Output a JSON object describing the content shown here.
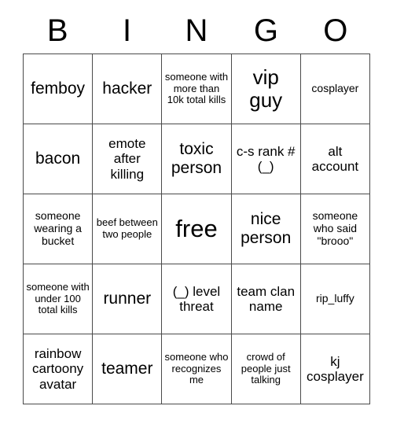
{
  "card": {
    "header_letters": [
      "B",
      "I",
      "N",
      "G",
      "O"
    ],
    "rows": [
      [
        {
          "text": "femboy",
          "size": "fs-md"
        },
        {
          "text": "hacker",
          "size": "fs-md"
        },
        {
          "text": "someone with more than 10k total kills",
          "size": "fs-xxs"
        },
        {
          "text": "vip guy",
          "size": "fs-lg"
        },
        {
          "text": "cosplayer",
          "size": "fs-xs"
        }
      ],
      [
        {
          "text": "bacon",
          "size": "fs-md"
        },
        {
          "text": "emote after killing",
          "size": "fs-sm"
        },
        {
          "text": "toxic person",
          "size": "fs-md"
        },
        {
          "text": "c-s rank # (_)",
          "size": "fs-sm"
        },
        {
          "text": "alt account",
          "size": "fs-sm"
        }
      ],
      [
        {
          "text": "someone wearing a bucket",
          "size": "fs-xs"
        },
        {
          "text": "beef between two people",
          "size": "fs-xxs"
        },
        {
          "text": "free",
          "size": "fs-xl"
        },
        {
          "text": "nice person",
          "size": "fs-md"
        },
        {
          "text": "someone who said \"brooo\"",
          "size": "fs-xs"
        }
      ],
      [
        {
          "text": "someone with under 100 total kills",
          "size": "fs-xxs"
        },
        {
          "text": "runner",
          "size": "fs-md"
        },
        {
          "text": "(_) level threat",
          "size": "fs-sm"
        },
        {
          "text": "team clan name",
          "size": "fs-sm"
        },
        {
          "text": "rip_luffy",
          "size": "fs-xs"
        }
      ],
      [
        {
          "text": "rainbow cartoony avatar",
          "size": "fs-sm"
        },
        {
          "text": "teamer",
          "size": "fs-md"
        },
        {
          "text": "someone who recognizes me",
          "size": "fs-xxs"
        },
        {
          "text": "crowd of people just talking",
          "size": "fs-xxs"
        },
        {
          "text": "kj cosplayer",
          "size": "fs-sm"
        }
      ]
    ]
  },
  "colors": {
    "border": "#4a4a4a",
    "text": "#000000",
    "background": "#ffffff"
  }
}
